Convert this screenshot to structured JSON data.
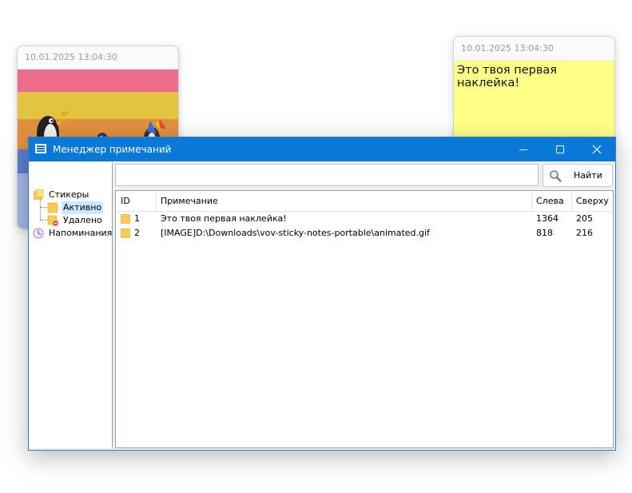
{
  "note_image": {
    "timestamp": "10.01.2025 13:04:30",
    "stripe_colors": [
      "#ee6d8e",
      "#e2c441",
      "#e0913f",
      "#5d7fd0",
      "#a6b7e6"
    ]
  },
  "note_text": {
    "timestamp": "10.01.2025 13:04:30",
    "body": "Это твоя первая наклейка!",
    "background": "#ffff88"
  },
  "window": {
    "title": "Менеджер примечаний",
    "accent": "#0a78d7",
    "controls": [
      "minimize-icon",
      "maximize-icon",
      "close-icon"
    ]
  },
  "tree": {
    "root": {
      "label": "Стикеры",
      "icon": "stickers-folder-icon"
    },
    "children": [
      {
        "label": "Активно",
        "icon": "active-note-icon",
        "selected": true
      },
      {
        "label": "Удалено",
        "icon": "deleted-note-icon",
        "selected": false
      }
    ],
    "reminders": {
      "label": "Напоминания",
      "icon": "clock-icon"
    }
  },
  "search": {
    "value": "",
    "placeholder": "",
    "button_label": "Найти",
    "button_icon": "search-icon"
  },
  "list": {
    "columns": [
      "ID",
      "Примечание",
      "Слева",
      "Сверху"
    ],
    "rows": [
      {
        "id": "1",
        "note": "Это твоя первая наклейка!",
        "left": "1364",
        "top": "205"
      },
      {
        "id": "2",
        "note": "[IMAGE]D:\\Downloads\\vov-sticky-notes-portable\\animated.gif",
        "left": "818",
        "top": "216"
      }
    ]
  }
}
